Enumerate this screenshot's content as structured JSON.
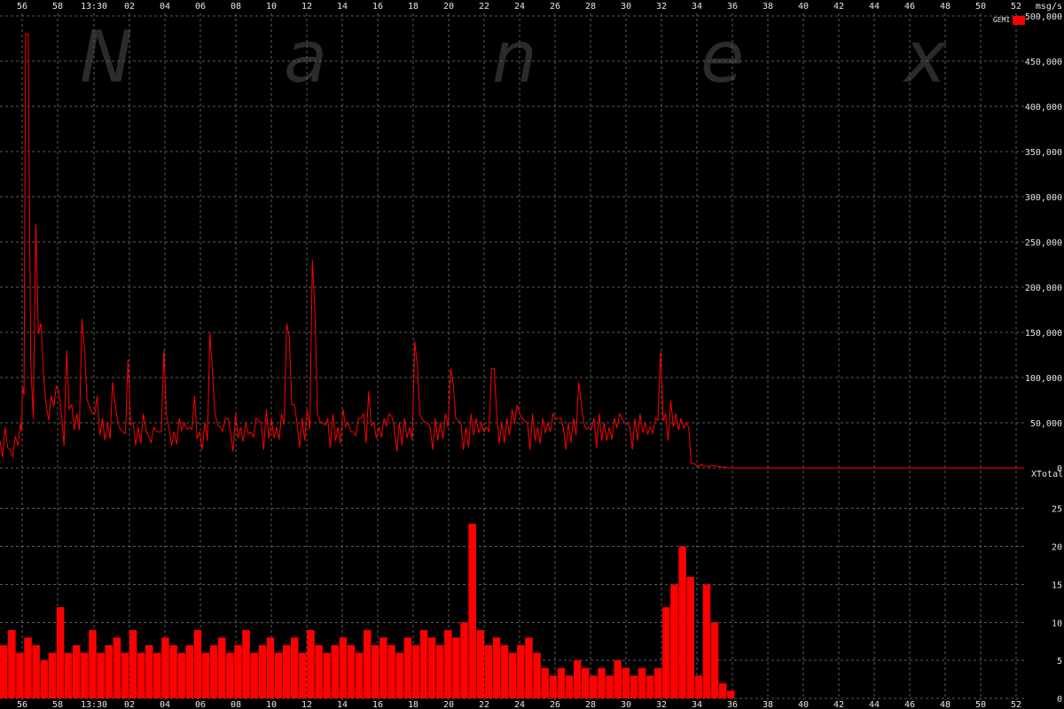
{
  "chart_data": [
    {
      "type": "line",
      "panel": "top",
      "title": "",
      "xlabel": "",
      "ylabel": "",
      "unit_label": "msg/s",
      "legend": [
        {
          "name": "GEMI",
          "color": "#ff0000"
        }
      ],
      "ylim": [
        0,
        500000
      ],
      "yticks": [
        0,
        50000,
        100000,
        150000,
        200000,
        250000,
        300000,
        350000,
        400000,
        450000,
        500000
      ],
      "ytick_labels": [
        "0",
        "50,000",
        "100,000",
        "150,000",
        "200,000",
        "250,000",
        "300,000",
        "350,000",
        "400,000",
        "450,000",
        "500,000"
      ],
      "x_tick_labels_top": [
        "56",
        "58",
        "13:30",
        "02",
        "04",
        "06",
        "08",
        "10",
        "12",
        "14",
        "16",
        "18",
        "20",
        "22",
        "24",
        "26",
        "28",
        "30",
        "32",
        "34",
        "36",
        "38",
        "40",
        "42",
        "44",
        "46",
        "48",
        "50",
        "52"
      ],
      "series": [
        {
          "name": "GEMI",
          "color": "#ff0000",
          "x": [
            0,
            0.5,
            1,
            1.5,
            2,
            2.2,
            2.5,
            3,
            3.5,
            4,
            4.5,
            5,
            5.5,
            6,
            6.5,
            7,
            7.5,
            8,
            8.5,
            9,
            9.5,
            10,
            10.5,
            11,
            11.5,
            12,
            12.5,
            13,
            13.5,
            14,
            14.5,
            15,
            15.5,
            16,
            16.5,
            17,
            17.5,
            18,
            18.5,
            19,
            19.5,
            20,
            20.5,
            21,
            21.5,
            22,
            22.5,
            23,
            23.5,
            24,
            24.5,
            25,
            25.5,
            26,
            26.5,
            27,
            27.5,
            28,
            28.5,
            29,
            29.5,
            30,
            30.5,
            31,
            31.5,
            32,
            32.5,
            33,
            33.5,
            34,
            34.5,
            35,
            35.5,
            36,
            36.5,
            37,
            37.5,
            38,
            38.5,
            39,
            39.5,
            40,
            40.5,
            41,
            41.5,
            42,
            42.5,
            43,
            43.5,
            44,
            44.5,
            45,
            45.5,
            46,
            46.5,
            47,
            47.5,
            48,
            48.5,
            49,
            49.5,
            50,
            50.5,
            51,
            51.5,
            52,
            52.5,
            53,
            53.5,
            54,
            54.5,
            55,
            55.5,
            56,
            56.5,
            57,
            57.5,
            58,
            58.5,
            59,
            59.5,
            60,
            60.5,
            61,
            61.5,
            62,
            62.5,
            63,
            63.5,
            64,
            64.5,
            65,
            65.5,
            66,
            66.5,
            67,
            67.5,
            68,
            68.5,
            69,
            69.5,
            70,
            70.5,
            71,
            71.5,
            72,
            72.5,
            73,
            73.5,
            74,
            74.5,
            75,
            75.5,
            76,
            76.5,
            77,
            77.5,
            78,
            78.5,
            79,
            79.5,
            80,
            80.5,
            81,
            81.5,
            82,
            82.5,
            83,
            83.5,
            84,
            84.5,
            85,
            85.5,
            86,
            86.5,
            87,
            87.5,
            88,
            88.5,
            89,
            89.5,
            90,
            90.5,
            91,
            91.5,
            92,
            92.5,
            93,
            93.5,
            94,
            94.5,
            95,
            95.5,
            96,
            96.5,
            97,
            97.5,
            98,
            98.5,
            99,
            99.5,
            100
          ],
          "values": [
            30000,
            45000,
            20000,
            35000,
            50000,
            90000,
            480000,
            120000,
            270000,
            160000,
            70000,
            80000,
            90000,
            60000,
            130000,
            70000,
            60000,
            165000,
            75000,
            60000,
            80000,
            55000,
            50000,
            95000,
            50000,
            40000,
            120000,
            50000,
            45000,
            60000,
            35000,
            45000,
            40000,
            130000,
            45000,
            40000,
            55000,
            50000,
            45000,
            80000,
            40000,
            50000,
            150000,
            60000,
            45000,
            55000,
            40000,
            60000,
            45000,
            50000,
            40000,
            55000,
            50000,
            65000,
            55000,
            45000,
            60000,
            160000,
            70000,
            50000,
            55000,
            65000,
            230000,
            60000,
            50000,
            55000,
            60000,
            45000,
            65000,
            50000,
            40000,
            55000,
            60000,
            85000,
            50000,
            45000,
            55000,
            60000,
            45000,
            50000,
            55000,
            45000,
            140000,
            60000,
            50000,
            45000,
            55000,
            50000,
            60000,
            110000,
            55000,
            50000,
            45000,
            60000,
            55000,
            50000,
            45000,
            110000,
            60000,
            50000,
            55000,
            65000,
            70000,
            55000,
            50000,
            60000,
            45000,
            55000,
            50000,
            60000,
            55000,
            45000,
            50000,
            55000,
            95000,
            50000,
            45000,
            55000,
            60000,
            50000,
            45000,
            55000,
            60000,
            50000,
            45000,
            55000,
            60000,
            50000,
            45000,
            55000,
            130000,
            60000,
            75000,
            60000,
            55000,
            50000,
            5000,
            3000,
            4000,
            2000,
            3000,
            2000,
            1000,
            0,
            0,
            0,
            0,
            0,
            0,
            0,
            0,
            0,
            0,
            0,
            0,
            0,
            0,
            0,
            0,
            0,
            0,
            0,
            0,
            0,
            0,
            0,
            0,
            0,
            0,
            0,
            0,
            0,
            0,
            0,
            0,
            0,
            0,
            0,
            0,
            0,
            0,
            0,
            0,
            0,
            0,
            0,
            0,
            0,
            0,
            0,
            0,
            0,
            0,
            0,
            0,
            0,
            0,
            0,
            0,
            0,
            0,
            0
          ]
        }
      ],
      "grid": true,
      "legend_position": "top-right"
    },
    {
      "type": "bar",
      "panel": "bottom",
      "title": "",
      "xlabel": "",
      "ylabel": "",
      "panel_label": "XTotal",
      "ylim": [
        0,
        28
      ],
      "yticks": [
        0,
        5,
        10,
        15,
        20,
        25
      ],
      "ytick_labels": [
        "0",
        "5",
        "10",
        "15",
        "20",
        "25"
      ],
      "x_tick_labels_bottom": [
        "56",
        "58",
        "13:30",
        "02",
        "04",
        "06",
        "08",
        "10",
        "12",
        "14",
        "16",
        "18",
        "20",
        "22",
        "24",
        "26",
        "28",
        "30",
        "32",
        "34",
        "36",
        "38",
        "40",
        "42",
        "44",
        "46",
        "48",
        "50",
        "52"
      ],
      "series": [
        {
          "name": "",
          "color": "#ff0000",
          "x": [
            0,
            1,
            2,
            3,
            4,
            5,
            6,
            7,
            8,
            9,
            10,
            11,
            12,
            13,
            14,
            15,
            16,
            17,
            18,
            19,
            20,
            21,
            22,
            23,
            24,
            25,
            26,
            27,
            28,
            29,
            30,
            31,
            32,
            33,
            34,
            35,
            36,
            37,
            38,
            39,
            40,
            41,
            42,
            43,
            44,
            45,
            46,
            47,
            48,
            49,
            50,
            51,
            52,
            53,
            54,
            55,
            56,
            57,
            58,
            59,
            60,
            61,
            62,
            63,
            64,
            65,
            66,
            67,
            68,
            69,
            70,
            71,
            72,
            73,
            74,
            75,
            76,
            77,
            78,
            79,
            80,
            81,
            82,
            83,
            84,
            85,
            86,
            87,
            88,
            89,
            90
          ],
          "values": [
            7,
            9,
            6,
            8,
            7,
            5,
            6,
            12,
            6,
            7,
            6,
            9,
            6,
            7,
            8,
            6,
            9,
            6,
            7,
            6,
            8,
            7,
            6,
            7,
            9,
            6,
            7,
            8,
            6,
            7,
            9,
            6,
            7,
            8,
            6,
            7,
            8,
            6,
            9,
            7,
            6,
            7,
            8,
            7,
            6,
            9,
            7,
            8,
            7,
            6,
            8,
            7,
            9,
            8,
            7,
            9,
            8,
            10,
            23,
            9,
            7,
            8,
            7,
            6,
            7,
            8,
            6,
            4,
            3,
            4,
            3,
            5,
            4,
            3,
            4,
            3,
            5,
            4,
            3,
            4,
            3,
            4,
            12,
            15,
            20,
            16,
            3,
            15,
            10,
            2,
            1
          ]
        }
      ],
      "grid": true
    }
  ],
  "watermark_letters": [
    "N",
    "a",
    "n",
    "e",
    "x"
  ]
}
